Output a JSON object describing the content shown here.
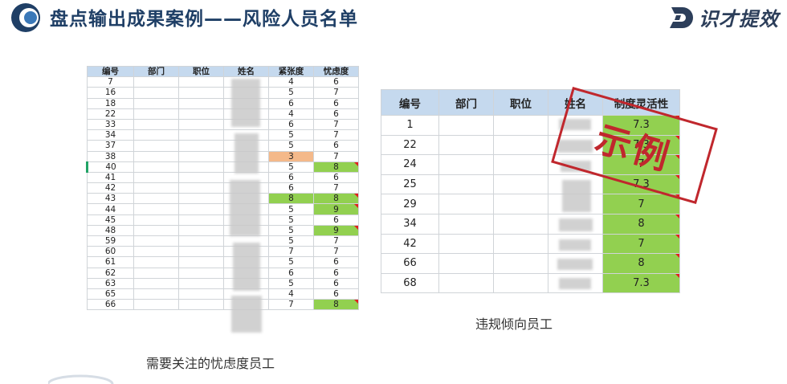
{
  "header": {
    "title": "盘点输出成果案例——风险人员名单",
    "brand": "识才提效"
  },
  "left_table": {
    "headers": [
      "编号",
      "部门",
      "职位",
      "姓名",
      "紧张度",
      "忧虑度"
    ],
    "rows": [
      {
        "id": "7",
        "tension": "4",
        "worry": "6"
      },
      {
        "id": "16",
        "tension": "5",
        "worry": "7"
      },
      {
        "id": "18",
        "tension": "6",
        "worry": "6"
      },
      {
        "id": "22",
        "tension": "4",
        "worry": "6"
      },
      {
        "id": "33",
        "tension": "6",
        "worry": "7"
      },
      {
        "id": "34",
        "tension": "5",
        "worry": "7"
      },
      {
        "id": "37",
        "tension": "5",
        "worry": "6"
      },
      {
        "id": "38",
        "tension": "3",
        "worry": "7"
      },
      {
        "id": "40",
        "tension": "5",
        "worry": "8"
      },
      {
        "id": "41",
        "tension": "6",
        "worry": "6"
      },
      {
        "id": "42",
        "tension": "6",
        "worry": "7"
      },
      {
        "id": "43",
        "tension": "8",
        "worry": "8"
      },
      {
        "id": "44",
        "tension": "5",
        "worry": "9"
      },
      {
        "id": "45",
        "tension": "5",
        "worry": "6"
      },
      {
        "id": "48",
        "tension": "5",
        "worry": "9"
      },
      {
        "id": "59",
        "tension": "5",
        "worry": "7"
      },
      {
        "id": "60",
        "tension": "7",
        "worry": "7"
      },
      {
        "id": "61",
        "tension": "5",
        "worry": "6"
      },
      {
        "id": "62",
        "tension": "6",
        "worry": "6"
      },
      {
        "id": "63",
        "tension": "5",
        "worry": "6"
      },
      {
        "id": "65",
        "tension": "4",
        "worry": "6"
      },
      {
        "id": "66",
        "tension": "7",
        "worry": "8"
      }
    ],
    "caption": "需要关注的忧虑度员工"
  },
  "right_table": {
    "headers": [
      "编号",
      "部门",
      "职位",
      "姓名",
      "制度灵活性"
    ],
    "rows": [
      {
        "id": "1",
        "flex": "7.3"
      },
      {
        "id": "22",
        "flex": "7.3"
      },
      {
        "id": "24",
        "flex": "7"
      },
      {
        "id": "25",
        "flex": "7.3"
      },
      {
        "id": "29",
        "flex": "7"
      },
      {
        "id": "34",
        "flex": "8"
      },
      {
        "id": "42",
        "flex": "7"
      },
      {
        "id": "66",
        "flex": "8"
      },
      {
        "id": "68",
        "flex": "7.3"
      }
    ],
    "caption": "违规倾向员工"
  },
  "stamp": {
    "text": "示例"
  },
  "colors": {
    "header_fill": "#c5d9ee",
    "highlight_green": "#92d050",
    "highlight_orange": "#f4b98a",
    "stamp_red": "#c0272d",
    "title_blue": "#1f3f66"
  }
}
